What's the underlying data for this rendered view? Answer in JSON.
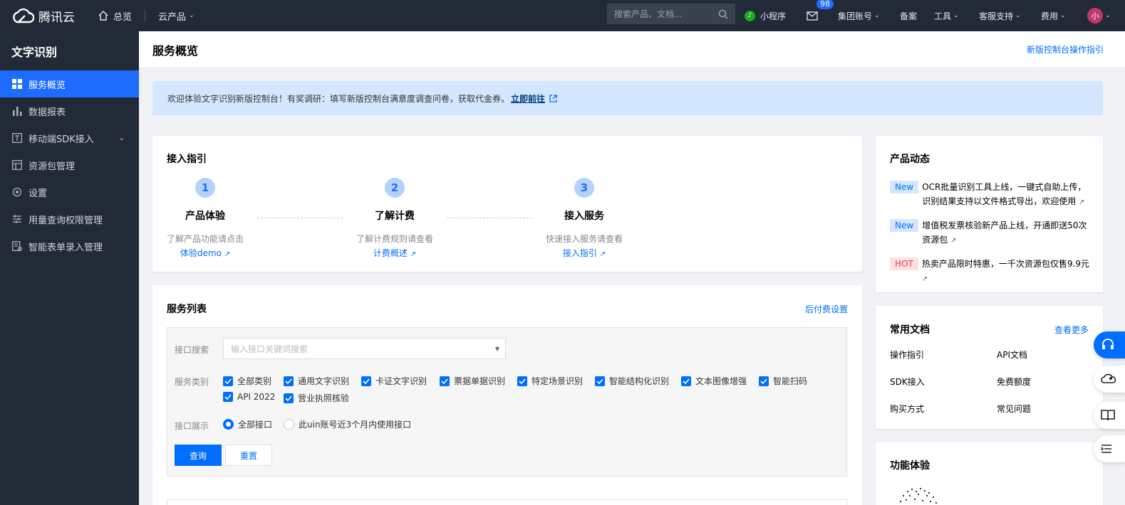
{
  "topbar": {
    "brand": "腾讯云",
    "home": "总览",
    "products": "云产品",
    "search_placeholder": "搜索产品、文档...",
    "mini_program": "小程序",
    "mail_badge": "98",
    "account": "集团账号",
    "beian": "备案",
    "tools": "工具",
    "support": "客服支持",
    "billing": "费用",
    "avatar": "小"
  },
  "sidebar": {
    "title": "文字识别",
    "items": [
      {
        "label": "服务概览"
      },
      {
        "label": "数据报表"
      },
      {
        "label": "移动端SDK接入"
      },
      {
        "label": "资源包管理"
      },
      {
        "label": "设置"
      },
      {
        "label": "用量查询权限管理"
      },
      {
        "label": "智能表单录入管理"
      }
    ]
  },
  "page": {
    "title": "服务概览",
    "guide_link": "新版控制台操作指引"
  },
  "banner": {
    "text": "欢迎体验文字识别新版控制台！有奖调研：填写新版控制台满意度调查问卷，获取代金券。",
    "link": "立即前往"
  },
  "guide": {
    "title": "接入指引",
    "steps": [
      {
        "num": "1",
        "name": "产品体验",
        "desc": "了解产品功能请点击",
        "link": "体验demo"
      },
      {
        "num": "2",
        "name": "了解计费",
        "desc": "了解计费规则请查看",
        "link": "计费概述"
      },
      {
        "num": "3",
        "name": "接入服务",
        "desc": "快速接入服务请查看",
        "link": "接入指引"
      }
    ]
  },
  "service_list": {
    "title": "服务列表",
    "postpaid": "后付费设置",
    "search_label": "接口搜索",
    "search_placeholder": "输入接口关键词搜索",
    "category_label": "服务类别",
    "categories": [
      "全部类别",
      "通用文字识别",
      "卡证文字识别",
      "票据单据识别",
      "特定场景识别",
      "智能结构化识别",
      "文本图像增强",
      "智能扫码",
      "API 2022",
      "营业执照核验"
    ],
    "display_label": "接口展示",
    "display_options": [
      "全部接口",
      "此uin账号近3个月内使用接口"
    ],
    "query_button": "查询",
    "reset_button": "重置"
  },
  "news": {
    "title": "产品动态",
    "items": [
      {
        "tag": "New",
        "text": "OCR批量识别工具上线，一键式自助上传，识别结果支持以文件格式导出，欢迎使用"
      },
      {
        "tag": "New",
        "text": "增值税发票核验新产品上线，开通即送50次资源包"
      },
      {
        "tag": "HOT",
        "text": "热卖产品限时特惠，一千次资源包仅售9.9元"
      }
    ]
  },
  "docs": {
    "title": "常用文档",
    "more": "查看更多",
    "items": [
      "操作指引",
      "API文档",
      "SDK接入",
      "免费额度",
      "购买方式",
      "常见问题"
    ]
  },
  "feature": {
    "title": "功能体验"
  },
  "colors": {
    "accent": "#006eff",
    "topbar": "#222a38",
    "banner": "#d5e7ff"
  }
}
